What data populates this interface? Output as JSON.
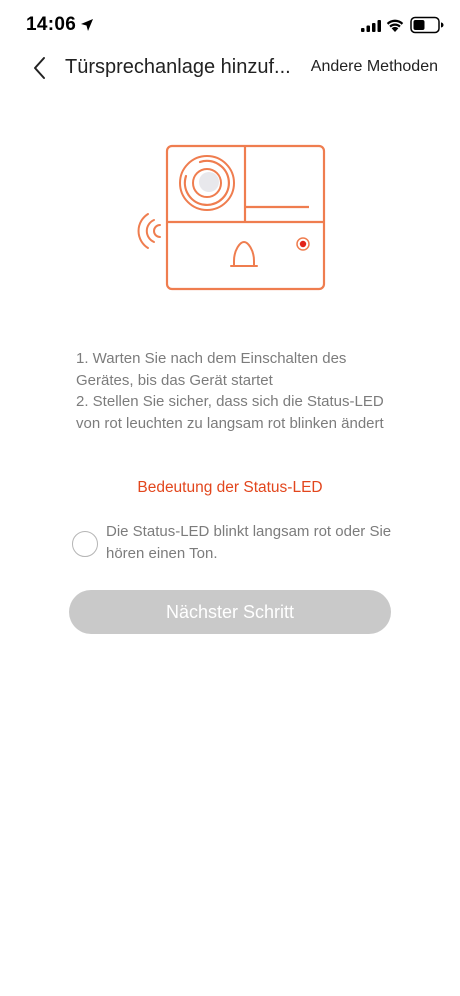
{
  "status_bar": {
    "time": "14:06"
  },
  "nav": {
    "title": "Türsprechanlage hinzuf...",
    "action_label": "Andere Methoden"
  },
  "instructions": {
    "step1": "1. Warten Sie nach dem Einschalten des Gerätes, bis das Gerät startet",
    "step2": "2. Stellen Sie sicher, dass sich die Status-LED von rot leuchten zu langsam rot blinken ändert"
  },
  "led_link_label": "Bedeutung der Status-LED",
  "confirm": {
    "label": "Die Status-LED blinkt langsam rot oder Sie hören einen Ton.",
    "checked": false
  },
  "next_button_label": "Nächster Schritt",
  "colors": {
    "accent": "#e2461d",
    "illustration": "#ef7d4f",
    "led": "#e2231a",
    "button_disabled": "#c9c9c9",
    "text_muted": "#7c7c7c"
  },
  "icons": {
    "back": "chevron-left-icon",
    "location": "location-arrow-icon",
    "signal": "cellular-signal-icon",
    "wifi": "wifi-icon",
    "battery": "battery-icon"
  }
}
